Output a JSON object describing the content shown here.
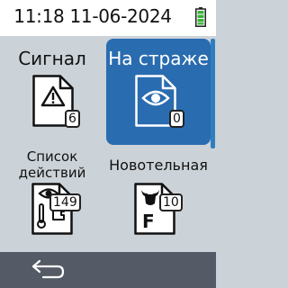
{
  "status": {
    "datetime": "11:18 11-06-2024",
    "battery_icon": "battery-full-icon",
    "battery_color": "#3cb13a"
  },
  "tiles": [
    {
      "label": "Сигнал",
      "badge": "6",
      "icon": "warning-document-icon"
    },
    {
      "label": "На страже",
      "badge": "0",
      "icon": "eye-document-icon",
      "selected": true
    },
    {
      "label_line1": "Список",
      "label_line2": "действий",
      "badge": "149",
      "icon": "action-list-icon"
    },
    {
      "label": "Новотельная",
      "badge": "10",
      "icon": "cow-document-icon"
    }
  ],
  "footer": {
    "back_icon": "back-arrow-icon"
  },
  "colors": {
    "accent": "#2a6cb0",
    "background": "#ccd3d8",
    "footer": "#545a66"
  }
}
